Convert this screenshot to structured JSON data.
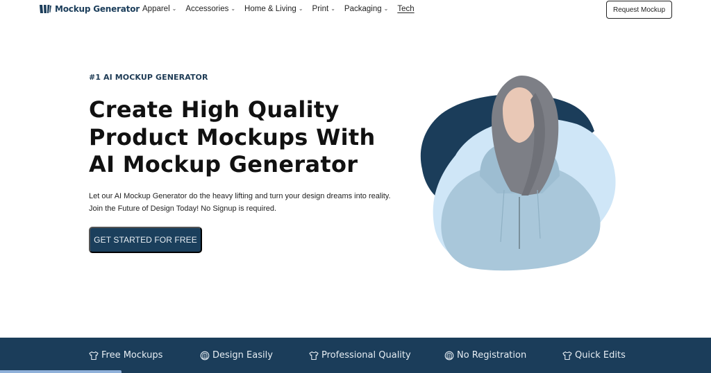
{
  "nav": {
    "logo_text": "Mockup Generator",
    "logo_icon": "logo-bars-icon",
    "items": [
      {
        "label": "Apparel",
        "has_dropdown": true
      },
      {
        "label": "Accessories",
        "has_dropdown": true
      },
      {
        "label": "Home & Living",
        "has_dropdown": true
      },
      {
        "label": "Print",
        "has_dropdown": true
      },
      {
        "label": "Packaging",
        "has_dropdown": true
      },
      {
        "label": "Tech",
        "has_dropdown": false
      }
    ],
    "chevron_glyph": "⌄",
    "request_button": "Request Mockup"
  },
  "hero": {
    "eyebrow": "#1 AI MOCKUP GENERATOR",
    "headline_lines": [
      "Create High Quality",
      "Product Mockups With",
      "AI Mockup Generator"
    ],
    "subtext_lines": [
      "Let our AI Mockup Generator do the heavy lifting and turn your design dreams into reality.",
      "Join the Future of Design Today! No Signup is required."
    ],
    "cta": "GET STARTED FOR FREE",
    "image_alt": "Woman wearing light blue hoodie"
  },
  "features": [
    {
      "label": "Free Mockups",
      "icon": "tshirt-icon"
    },
    {
      "label": "Design Easily",
      "icon": "hoodie-icon"
    },
    {
      "label": "Professional Quality",
      "icon": "tshirt-icon"
    },
    {
      "label": "No Registration",
      "icon": "hoodie-icon"
    },
    {
      "label": "Quick Edits",
      "icon": "tshirt-icon"
    }
  ],
  "colors": {
    "brand_dark": "#1b3d5a",
    "light_blob": "#cfe6f7",
    "band_text": "#e6edf3",
    "progress": "#8fb0d9"
  }
}
